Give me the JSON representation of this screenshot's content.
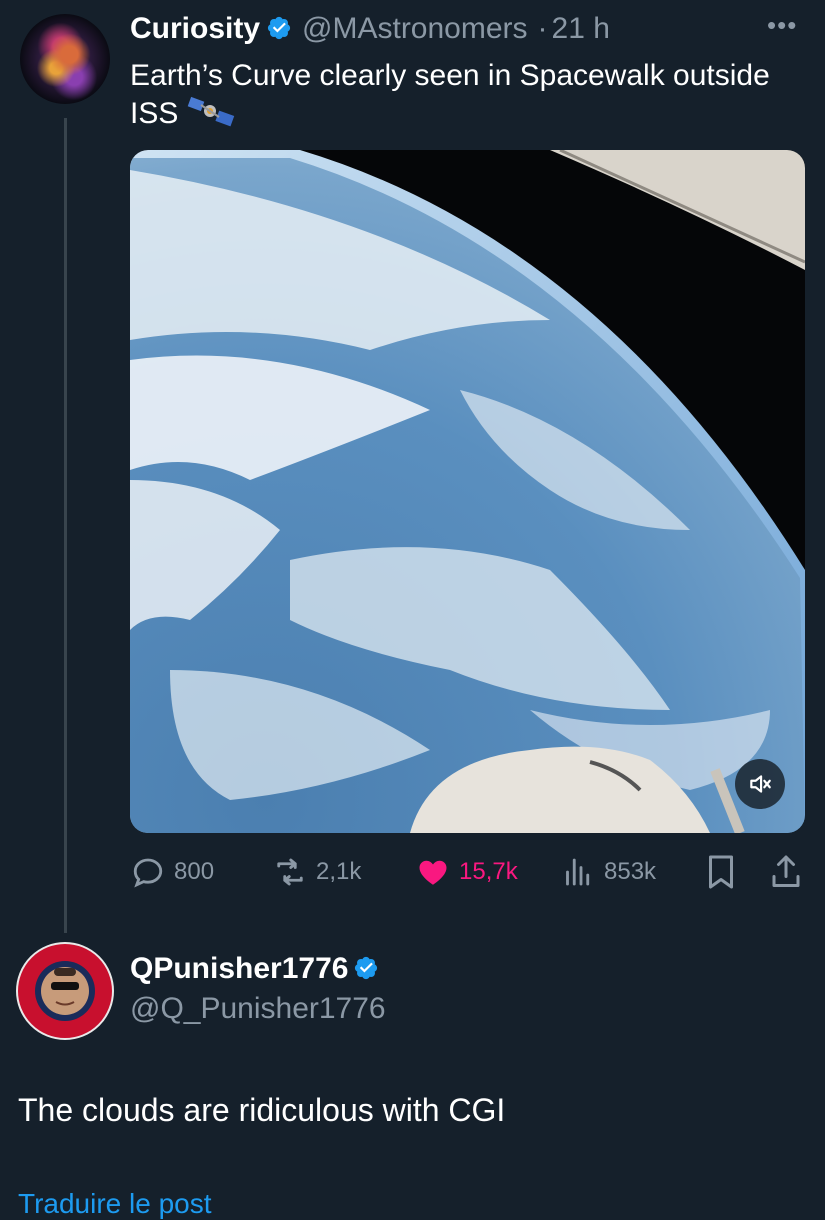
{
  "post1": {
    "author_name": "Curiosity",
    "handle": "@MAstronomers",
    "separator": "·",
    "time": "21 h",
    "more_icon": "more-horizontal-icon",
    "text": "Earth’s Curve clearly seen in Spacewalk outside ISS",
    "emoji_icon": "satellite-icon",
    "media": {
      "type": "video",
      "description_icon": "mute-icon"
    },
    "actions": {
      "replies": "800",
      "reposts": "2,1k",
      "likes": "15,7k",
      "views": "853k"
    }
  },
  "post2": {
    "author_name": "QPunisher1776",
    "handle": "@Q_Punisher1776",
    "text": "The clouds are ridiculous with CGI",
    "translate_link": "Traduire le post"
  },
  "colors": {
    "background": "#15202b",
    "text": "#ffffff",
    "muted": "#8b98a5",
    "accent": "#1d9bf0",
    "like": "#f91880",
    "thread_line": "#38444d"
  }
}
